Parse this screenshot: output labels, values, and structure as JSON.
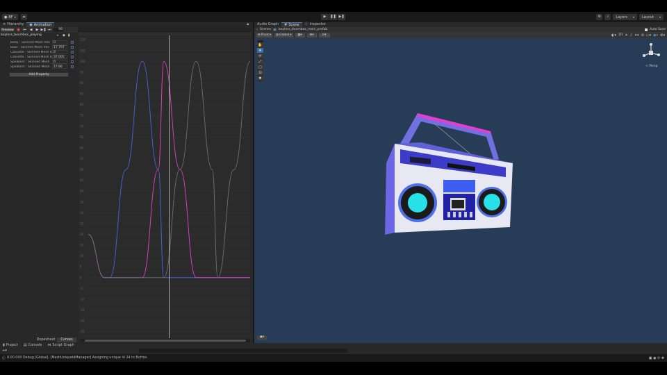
{
  "topbar": {
    "account_label": "BF",
    "layers_label": "Layers",
    "layout_label": "Layout"
  },
  "left_tabs": [
    {
      "label": "Hierarchy",
      "icon": "hierarchy-icon"
    },
    {
      "label": "Animation",
      "icon": "animation-icon"
    }
  ],
  "animation": {
    "preview_label": "Preview",
    "frame_value": "98",
    "clip_name": "boyloss_boombox_playing",
    "add_property_label": "Add Property",
    "dopesheet_label": "Dopesheet",
    "curves_label": "Curves",
    "properties": [
      {
        "name": "Body : Skinned Mesh Ren",
        "value": "0"
      },
      {
        "name": "Bass : Skinned Mesh Ren",
        "value": "17.797"
      },
      {
        "name": "Cassette : Skinned Mesh R",
        "value": "0"
      },
      {
        "name": "Cassette : Skinned Mesh R",
        "value": "37.005"
      },
      {
        "name": "Speakers : Skinned Mesh",
        "value": "0"
      },
      {
        "name": "Speakers : Skinned Mesh",
        "value": "17.66"
      }
    ],
    "y_ticks": [
      "110",
      "105",
      "100",
      "95",
      "90",
      "85",
      "80",
      "75",
      "70",
      "65",
      "60",
      "55",
      "50",
      "45",
      "40",
      "35",
      "30",
      "25",
      "20",
      "15",
      "10",
      "5",
      "0",
      "-5",
      "-10",
      "-15",
      "-20",
      "-25"
    ]
  },
  "chart_data": {
    "type": "line",
    "ylim": [
      -28,
      112
    ],
    "x": [
      0,
      6,
      8,
      14,
      20,
      26,
      28,
      34,
      40,
      46,
      48,
      54,
      60
    ],
    "playhead_x": 30,
    "series": [
      {
        "color": "#4a5fd0",
        "values": [
          20,
          0,
          0,
          50,
          100,
          50,
          0,
          0,
          0,
          0,
          0,
          0,
          0
        ]
      },
      {
        "color": "#d63fc0",
        "values": [
          20,
          0,
          0,
          0,
          0,
          50,
          100,
          50,
          0,
          0,
          0,
          0,
          0
        ]
      },
      {
        "color": "#6a6a6a",
        "values": [
          20,
          0,
          0,
          0,
          0,
          0,
          0,
          50,
          100,
          50,
          0,
          50,
          100
        ]
      }
    ]
  },
  "right_tabs": [
    {
      "label": "Audio Graph",
      "icon": ""
    },
    {
      "label": "Scene",
      "icon": "scene-icon"
    },
    {
      "label": "Inspector",
      "icon": "info-icon"
    }
  ],
  "scene": {
    "breadcrumb_root": "Scenes",
    "breadcrumb_prefab": "boyloss_boombox_main_prefab",
    "auto_save_label": "Auto Save",
    "pivot_label": "Pivot",
    "global_label": "Global",
    "mode_2d_label": "2D",
    "persp_label": "< Persp",
    "background_color": "#263c57"
  },
  "bottom_tabs": [
    {
      "label": "Project",
      "icon": "folder-icon"
    },
    {
      "label": "Console",
      "icon": "console-icon"
    },
    {
      "label": "Script Graph",
      "icon": "graph-icon"
    }
  ],
  "status": {
    "message": "0:00.000 Debug [Global]: [MeshUniqueIdManager] Assigning unique Id 24 to Button."
  }
}
